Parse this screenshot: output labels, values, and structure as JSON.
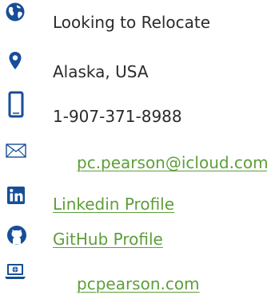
{
  "contact": {
    "relocation": {
      "icon": "globe-icon",
      "text": "Looking to Relocate"
    },
    "location": {
      "icon": "map-pin-icon",
      "text": "Alaska, USA"
    },
    "phone": {
      "icon": "mobile-phone-icon",
      "text": "1-907-371-8988"
    },
    "email": {
      "icon": "envelope-icon",
      "text": "pc.pearson@icloud.com"
    },
    "linkedin": {
      "icon": "linkedin-icon",
      "text": "Linkedin Profile"
    },
    "github": {
      "icon": "github-icon",
      "text": "GitHub Profile"
    },
    "website": {
      "icon": "laptop-globe-icon",
      "text": "pcpearson.com"
    }
  },
  "colors": {
    "icon": "#174e98",
    "text": "#2b2b2b",
    "link": "#5e9e3a"
  }
}
